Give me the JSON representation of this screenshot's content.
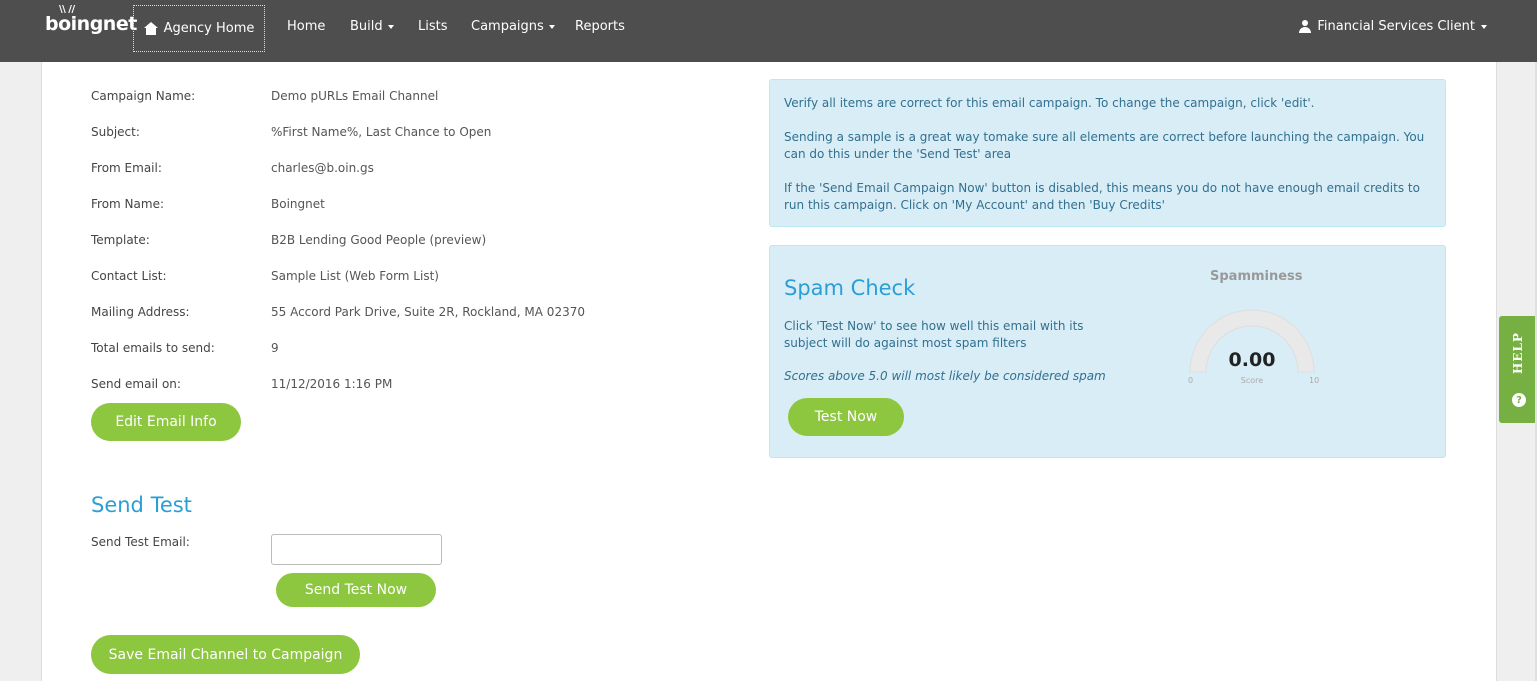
{
  "nav": {
    "logo": "boingnet",
    "agency_home": "Agency Home",
    "items": [
      {
        "label": "Home"
      },
      {
        "label": "Build"
      },
      {
        "label": "Lists"
      },
      {
        "label": "Campaigns"
      },
      {
        "label": "Reports"
      }
    ],
    "user": "Financial Services Client"
  },
  "details": [
    {
      "label": "Campaign Name:",
      "value": "Demo pURLs Email Channel"
    },
    {
      "label": "Subject:",
      "value": "%First Name%, Last Chance to Open"
    },
    {
      "label": "From Email:",
      "value": "charles@b.oin.gs"
    },
    {
      "label": "From Name:",
      "value": "Boingnet"
    },
    {
      "label": "Template:",
      "value": "B2B Lending Good People (preview)"
    },
    {
      "label": "Contact List:",
      "value": "Sample List (Web Form List)"
    },
    {
      "label": "Mailing Address:",
      "value": "55 Accord Park Drive, Suite 2R, Rockland, MA 02370"
    },
    {
      "label": "Total emails to send:",
      "value": "9"
    },
    {
      "label": "Send email on:",
      "value": "11/12/2016 1:16 PM"
    }
  ],
  "edit_button": "Edit Email Info",
  "send_test": {
    "title": "Send Test",
    "label": "Send Test Email:",
    "input_value": "",
    "button": "Send Test Now"
  },
  "save_button": "Save Email Channel to Campaign",
  "info": {
    "p1": "Verify all items are correct for this email campaign. To change the campaign, click 'edit'.",
    "p2": "Sending a sample is a great way tomake sure all elements are correct before launching the campaign. You can do this under the 'Send Test' area",
    "p3": "If the 'Send Email Campaign Now' button is disabled, this means you do not have enough email credits to run this campaign. Click on 'My Account' and then 'Buy Credits'"
  },
  "spam": {
    "title": "Spam Check",
    "text": "Click 'Test Now' to see how well this email with its subject will do against most spam filters",
    "note": "Scores above 5.0 will most likely be considered spam",
    "button": "Test Now",
    "gauge_title": "Spamminess",
    "score": "0.00",
    "score_label": "Score",
    "min": "0",
    "max": "10"
  },
  "help": "HELP",
  "colors": {
    "accent_green": "#8dc63f",
    "title_blue": "#2a9fd6",
    "nav_bg": "#4e4e4e",
    "info_bg": "#d9edf7"
  }
}
